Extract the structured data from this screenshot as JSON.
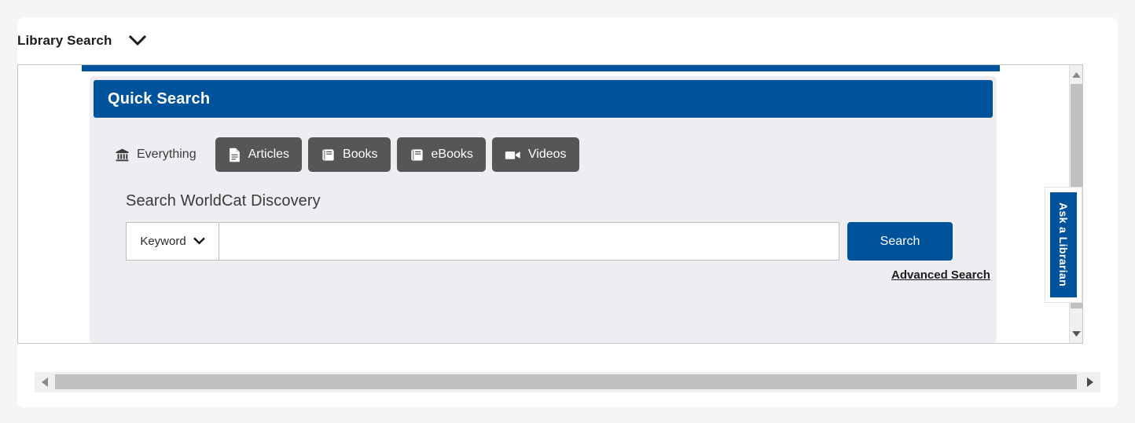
{
  "widget": {
    "title": "Library Search",
    "caret_icon": "chevron-down-icon"
  },
  "quick_search": {
    "banner_title": "Quick Search",
    "tabs": [
      {
        "label": "Everything",
        "icon": "bank-icon",
        "active": true
      },
      {
        "label": "Articles",
        "icon": "document-icon",
        "active": false
      },
      {
        "label": "Books",
        "icon": "book-icon",
        "active": false
      },
      {
        "label": "eBooks",
        "icon": "book-icon",
        "active": false
      },
      {
        "label": "Videos",
        "icon": "video-camera-icon",
        "active": false
      }
    ],
    "form_heading": "Search WorldCat Discovery",
    "index_select": {
      "value": "Keyword",
      "caret_icon": "chevron-down-icon",
      "options": [
        "Keyword"
      ]
    },
    "query_input": {
      "value": "",
      "placeholder": ""
    },
    "search_button_label": "Search",
    "advanced_search_label": "Advanced Search"
  },
  "ask_librarian": {
    "label": "Ask a Librarian"
  },
  "scrollbars": {
    "vertical": {
      "up_icon": "triangle-up-icon",
      "down_icon": "triangle-down-icon"
    },
    "horizontal": {
      "left_icon": "triangle-left-icon",
      "right_icon": "triangle-right-icon"
    }
  },
  "colors": {
    "brand_blue": "#00529b",
    "tab_gray": "#565656",
    "panel_gray": "#eeeef2",
    "page_bg": "#f4f5f7"
  }
}
